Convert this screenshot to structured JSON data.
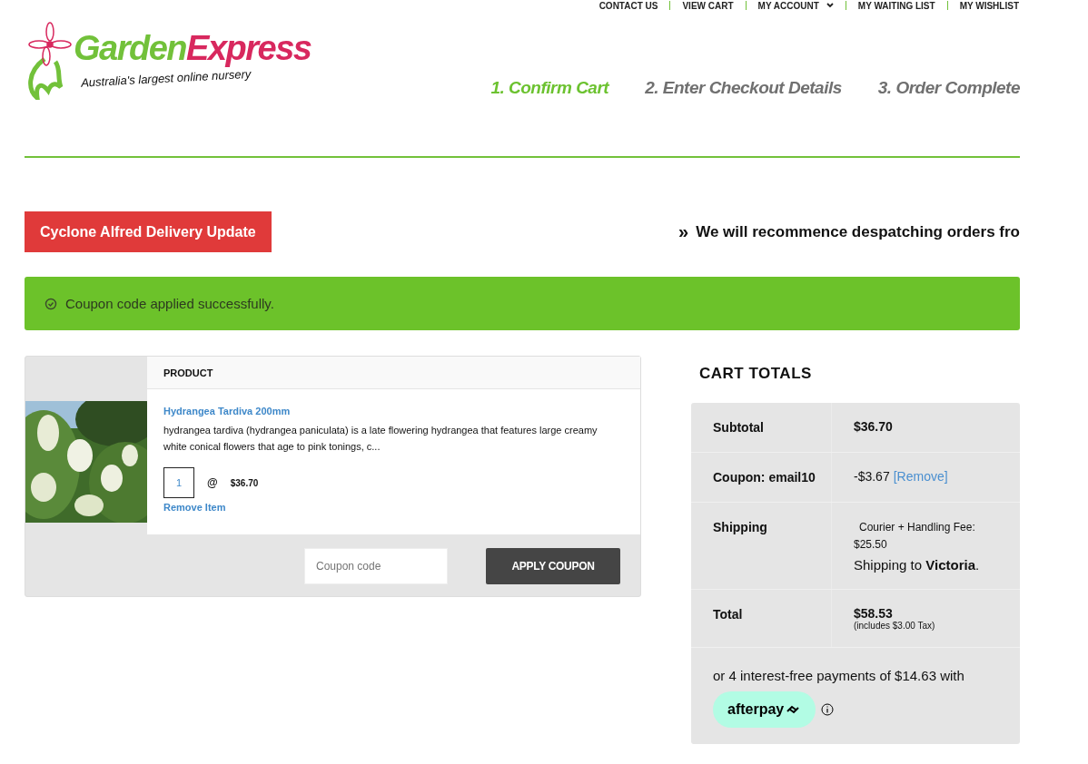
{
  "top_nav": [
    {
      "label": "CONTACT US",
      "has_dropdown": false
    },
    {
      "label": "VIEW CART",
      "has_dropdown": false
    },
    {
      "label": "MY ACCOUNT",
      "has_dropdown": true
    },
    {
      "label": "MY WAITING LIST",
      "has_dropdown": false
    },
    {
      "label": "MY WISHLIST",
      "has_dropdown": false
    }
  ],
  "logo": {
    "brand_first": "Garden",
    "brand_second": "Express",
    "tagline": "Australia's largest online nursery"
  },
  "steps": [
    {
      "label": "1. Confirm Cart",
      "selected": true
    },
    {
      "label": "2. Enter Checkout Details",
      "selected": false
    },
    {
      "label": "3. Order Complete",
      "selected": false
    }
  ],
  "announcement": {
    "button": "Cyclone Alfred Delivery Update",
    "ticker_icon": "»",
    "ticker": "We will recommence despatching orders fro"
  },
  "notice": {
    "message": "Coupon code applied successfully."
  },
  "cart": {
    "column": "PRODUCT",
    "items": [
      {
        "kind": "picture",
        "name": "Hydrangea Tardiva 200mm",
        "description": "hydrangea tardiva (hydrangea paniculata) is a late flowering hydrangea that features large creamy white conical flowers that age to pink tonings, c...",
        "quantity": "1",
        "at": "@",
        "price": "$36.70",
        "remove": "Remove Item"
      }
    ],
    "coupon_placeholder": "Coupon code",
    "apply_button": "APPLY COUPON"
  },
  "totals": {
    "title": "CART TOTALS",
    "rows": [
      {
        "kind": "subtotal",
        "label": "Subtotal",
        "value": "$36.70"
      },
      {
        "kind": "coupon",
        "label": "Coupon: email10",
        "value": "-$3.67",
        "link": "[Remove]"
      },
      {
        "kind": "shipping",
        "label": "Shipping",
        "value": "Courier + Handling Fee: $25.50",
        "note": "Shipping to **Victoria**."
      },
      {
        "kind": "total",
        "label": "Total",
        "value": "$58.53",
        "note": "(includes $3.00 Tax)"
      }
    ],
    "afterpay_text": "or 4 interest-free payments of $14.63 with",
    "afterpay_logo": "afterpay"
  }
}
